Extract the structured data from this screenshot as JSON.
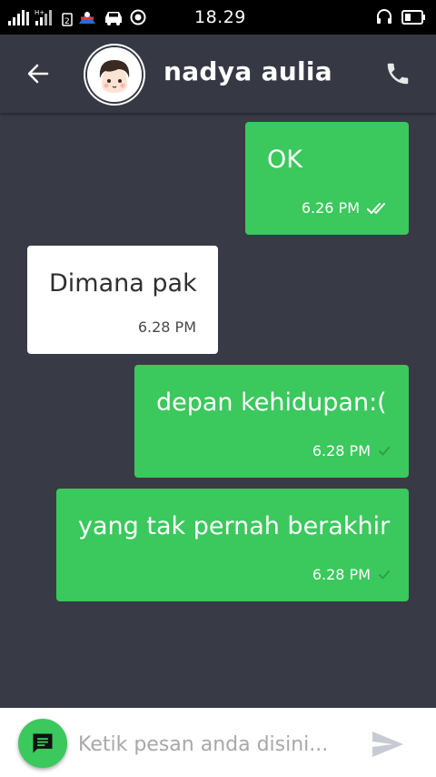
{
  "status_bar": {
    "time": "18.29",
    "icons": [
      "signal-bars-icon",
      "signal-bars-icon",
      "sim-2-icon",
      "app-notification-icon",
      "car-icon",
      "location-icon",
      "headset-icon",
      "battery-icon"
    ]
  },
  "header": {
    "contact_name": "nadya aulia",
    "icons": [
      "back-arrow-icon",
      "avatar",
      "phone-icon"
    ]
  },
  "messages": [
    {
      "direction": "out",
      "text": "OK",
      "time": "6.26 PM",
      "status": "read"
    },
    {
      "direction": "in",
      "text": "Dimana pak",
      "time": "6.28 PM"
    },
    {
      "direction": "out",
      "text": "depan kehidupan:(",
      "time": "6.28 PM",
      "status": "sent"
    },
    {
      "direction": "out",
      "text": "yang tak pernah berakhir",
      "time": "6.28 PM",
      "status": "sent"
    }
  ],
  "composer": {
    "placeholder": "Ketik pesan anda disini...",
    "value": "",
    "icons": [
      "chat-bubble-icon",
      "send-icon"
    ]
  },
  "colors": {
    "background": "#383b46",
    "header": "#363944",
    "outgoing_bubble": "#3bc85d",
    "incoming_bubble": "#ffffff",
    "status_bar": "#000000"
  }
}
